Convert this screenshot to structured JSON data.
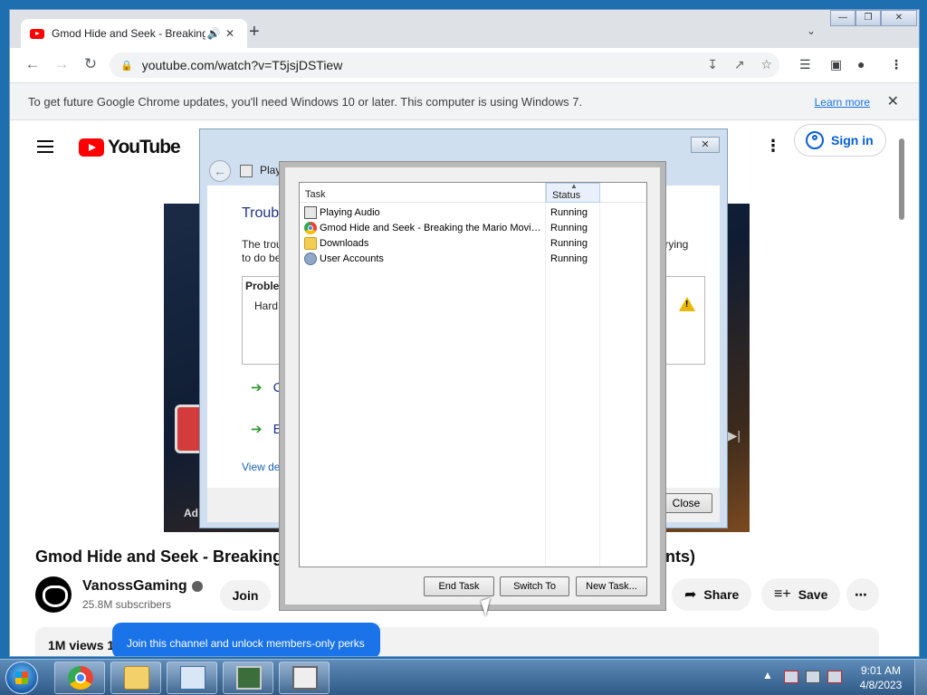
{
  "browser": {
    "tab_title": "Gmod Hide and Seek - Breaking",
    "address": "youtube.com/watch?v=T5jsjDSTiew",
    "infobar_text": "To get future Google Chrome updates, you'll need Windows 10 or later. This computer is using Windows 7.",
    "infobar_link": "Learn more"
  },
  "youtube": {
    "logo_text": "YouTube",
    "sign_in": "Sign in",
    "video_title": "Gmod Hide and Seek - Breaking",
    "video_title_tail": "nts)",
    "channel_name": "VanossGaming",
    "subscribers": "25.8M subscribers",
    "join": "Join",
    "share": "Share",
    "save": "Save",
    "views": "1M views  1",
    "ad_label": "Ad",
    "tooltip": "Join this channel and unlock members-only perks"
  },
  "troubleshooter": {
    "breadcrumb": "Play",
    "title": "Troub",
    "text_line1": "The trou",
    "text_line2": "to do be",
    "text_right": "e trying",
    "problems_header": "Problem",
    "problem_item": "Hard",
    "option1": "C",
    "option2": "E",
    "view_details": "View de",
    "close_button": "Close"
  },
  "task_manager": {
    "columns": {
      "task": "Task",
      "status": "Status"
    },
    "rows": [
      {
        "name": "Playing Audio",
        "status": "Running",
        "icon": "document-icon"
      },
      {
        "name": "Gmod Hide and Seek - Breaking the Mario Movie ...",
        "status": "Running",
        "icon": "chrome-icon"
      },
      {
        "name": "Downloads",
        "status": "Running",
        "icon": "folder-icon"
      },
      {
        "name": "User Accounts",
        "status": "Running",
        "icon": "users-icon"
      }
    ],
    "buttons": {
      "end_task": "End Task",
      "switch_to": "Switch To",
      "new_task": "New Task..."
    }
  },
  "taskbar": {
    "time": "9:01 AM",
    "date": "4/8/2023"
  },
  "colors": {
    "youtube_red": "#ff0000",
    "link_blue": "#065fd4",
    "tooltip_blue": "#1a73e8",
    "taskbar": "#2f5a87"
  }
}
